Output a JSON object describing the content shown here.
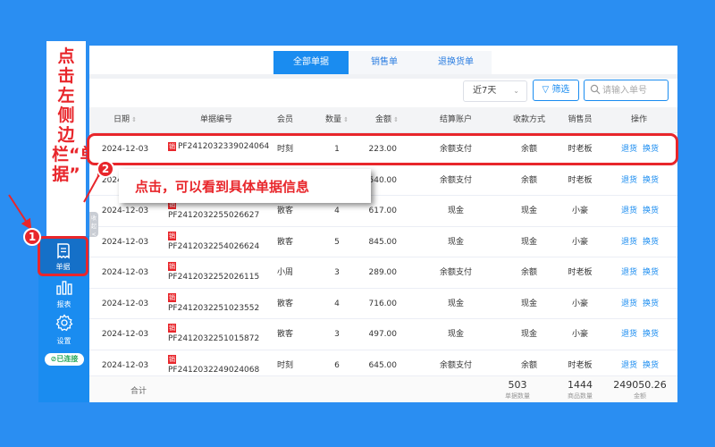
{
  "annotation": {
    "sidebar_instruction": "点击左侧边栏“单据”",
    "callout_text": "点击，可以看到具体单据信息",
    "marker_1": "1",
    "marker_2": "2",
    "accent_color": "#e8262b"
  },
  "sidebar": {
    "items": [
      {
        "label": "单据",
        "icon": "receipt-icon",
        "active": true
      },
      {
        "label": "报表",
        "icon": "bar-chart-icon"
      },
      {
        "label": "设置",
        "icon": "gear-icon"
      }
    ],
    "status": "已连接",
    "collapse_label": "收起<"
  },
  "tabs": [
    "全部单据",
    "销售单",
    "退换货单"
  ],
  "filters": {
    "date_range": "近7天",
    "filter_button": "筛选",
    "search_placeholder": "请输入单号"
  },
  "table": {
    "headers": [
      "日期",
      "单据编号",
      "会员",
      "数量",
      "金额",
      "结算账户",
      "收款方式",
      "销售员",
      "操作"
    ],
    "sale_tag": "销",
    "actions": [
      "退货",
      "换货"
    ],
    "rows": [
      {
        "date": "2024-12-03",
        "order": "PF2412032339024064",
        "member": "时刻",
        "qty": "1",
        "amount": "223.00",
        "account": "余额支付",
        "payment": "余额",
        "seller": "时老板"
      },
      {
        "date": "2024-12-03",
        "order": "PF2412032...",
        "member": "",
        "qty": "",
        "amount": "540.00",
        "account": "余额支付",
        "payment": "余额",
        "seller": "时老板"
      },
      {
        "date": "2024-12-03",
        "order": "PF2412032255026627",
        "member": "散客",
        "qty": "4",
        "amount": "617.00",
        "account": "现金",
        "payment": "现金",
        "seller": "小豪"
      },
      {
        "date": "2024-12-03",
        "order": "PF2412032254026624",
        "member": "散客",
        "qty": "5",
        "amount": "845.00",
        "account": "现金",
        "payment": "现金",
        "seller": "小豪"
      },
      {
        "date": "2024-12-03",
        "order": "PF2412032252026115",
        "member": "小周",
        "qty": "3",
        "amount": "289.00",
        "account": "余额支付",
        "payment": "余额",
        "seller": "时老板"
      },
      {
        "date": "2024-12-03",
        "order": "PF2412032251023552",
        "member": "散客",
        "qty": "4",
        "amount": "716.00",
        "account": "现金",
        "payment": "现金",
        "seller": "小豪"
      },
      {
        "date": "2024-12-03",
        "order": "PF2412032251015872",
        "member": "散客",
        "qty": "3",
        "amount": "497.00",
        "account": "现金",
        "payment": "现金",
        "seller": "小豪"
      },
      {
        "date": "2024-12-03",
        "order": "PF2412032249024068",
        "member": "时刻",
        "qty": "6",
        "amount": "645.00",
        "account": "余额支付",
        "payment": "余额",
        "seller": "时老板"
      }
    ],
    "footer": {
      "label": "合计",
      "orders_count": "503",
      "orders_label": "单据数量",
      "items_count": "1444",
      "items_label": "商品数量",
      "total_amount": "249050.26",
      "amount_label": "金额"
    }
  }
}
